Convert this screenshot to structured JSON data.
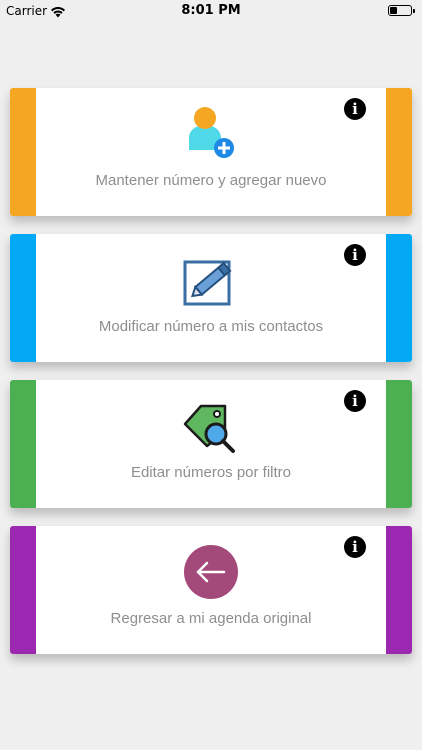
{
  "status_bar": {
    "carrier": "Carrier",
    "time": "8:01 PM",
    "icons": [
      "wifi-icon",
      "battery-icon"
    ]
  },
  "options": [
    {
      "label": "Mantener número y agregar nuevo",
      "color": "#f5a623",
      "icon": "add-contact-icon"
    },
    {
      "label": "Modificar número a mis contactos",
      "color": "#03a9f4",
      "icon": "edit-icon"
    },
    {
      "label": "Editar números por filtro",
      "color": "#4caf50",
      "icon": "tag-search-icon"
    },
    {
      "label": "Regresar a mi agenda original",
      "color": "#9c27b0",
      "icon": "back-arrow-icon"
    }
  ],
  "info_icon": "info-icon"
}
